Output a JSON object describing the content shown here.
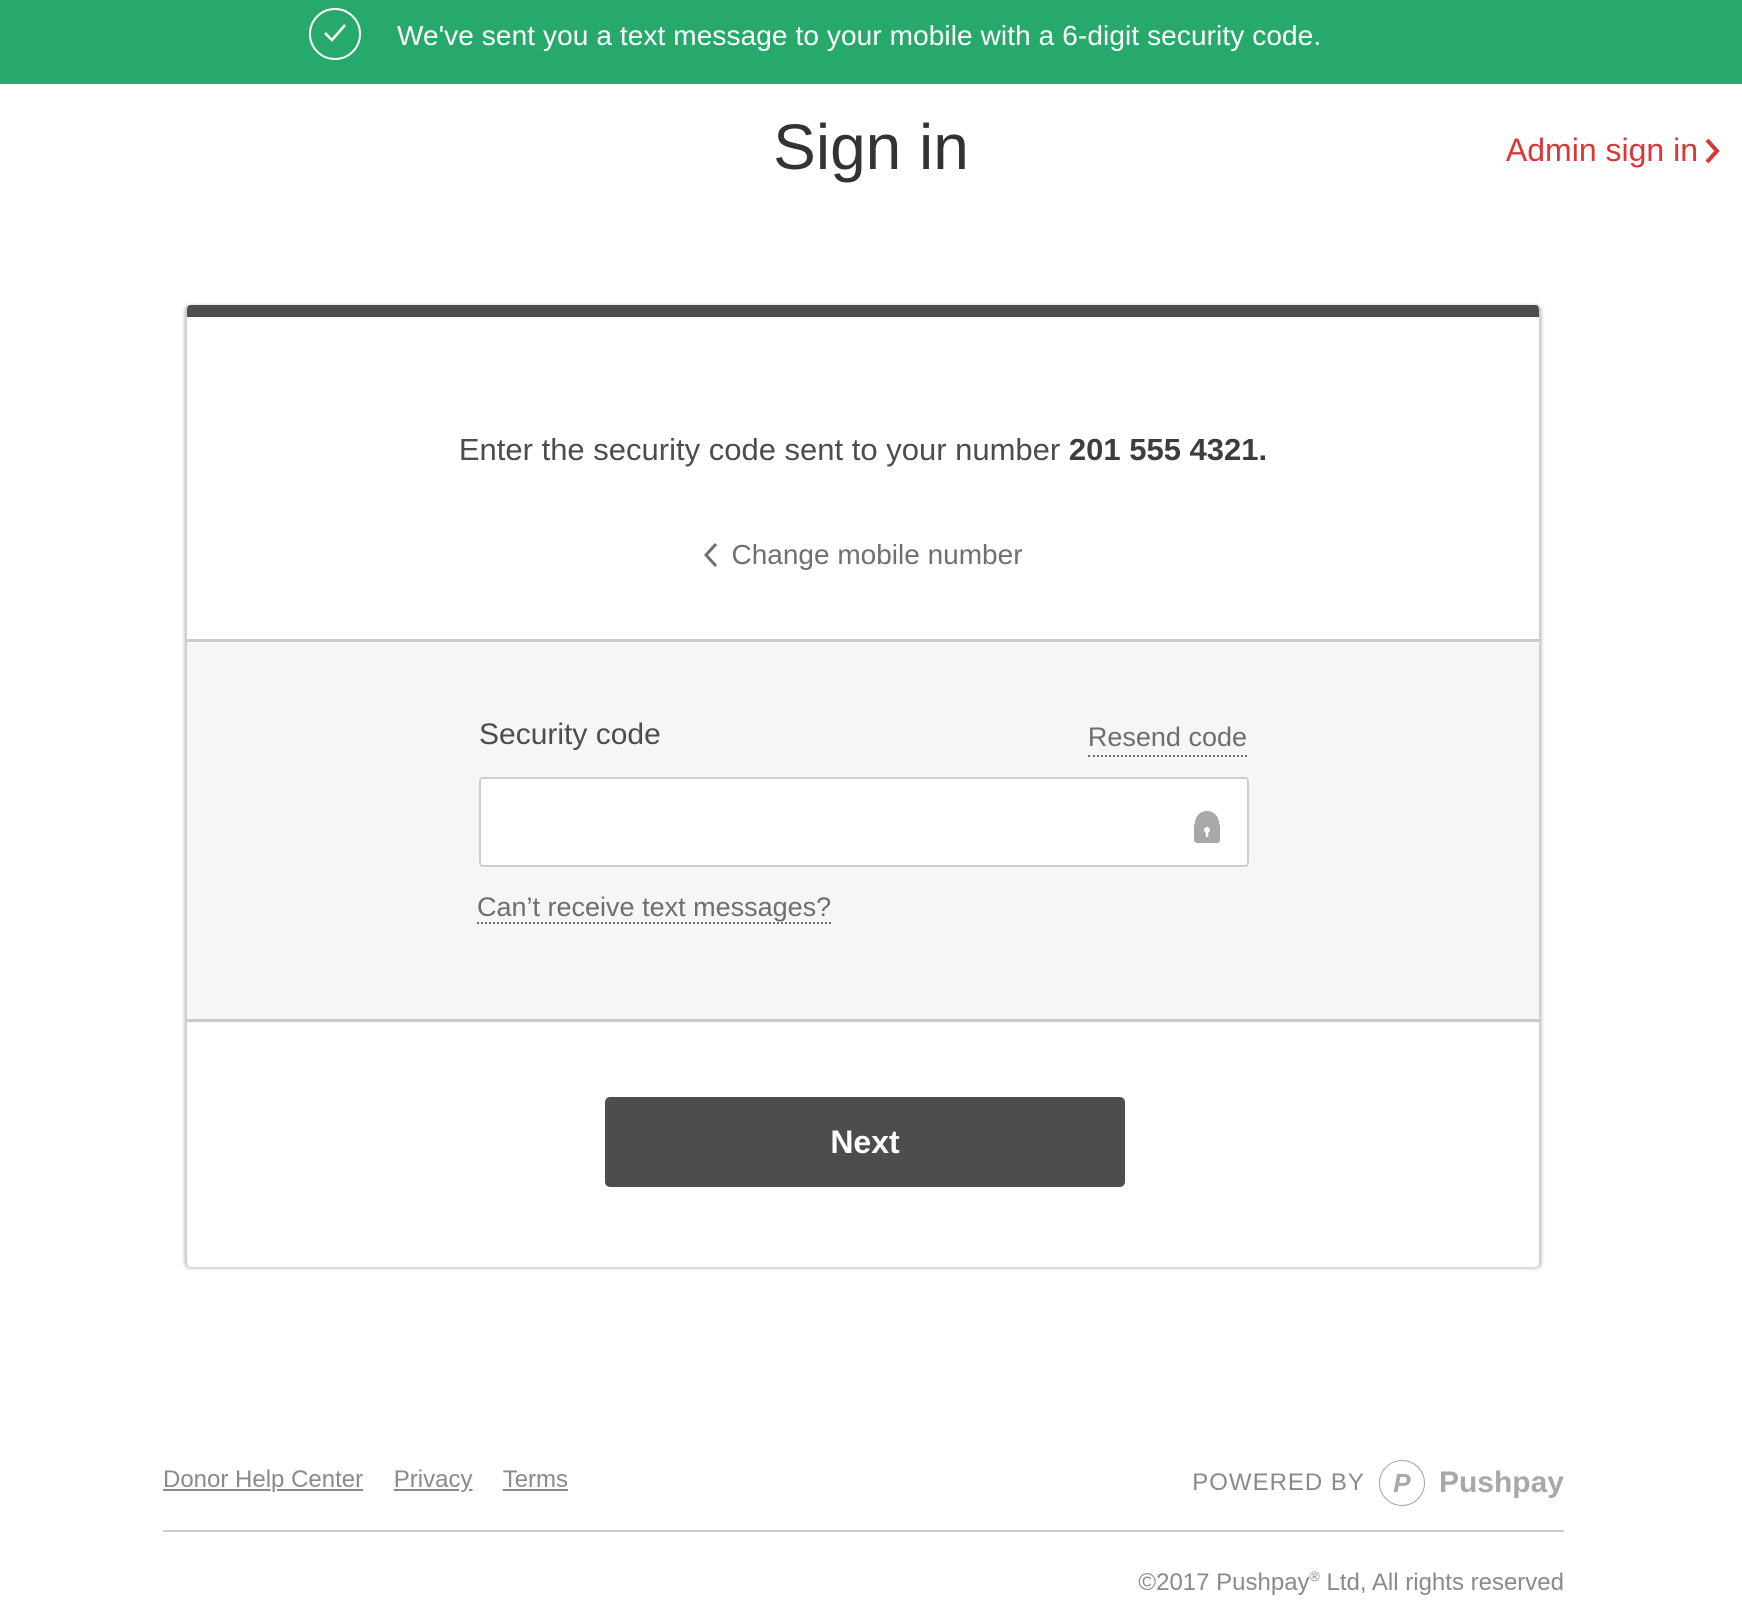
{
  "banner": {
    "icon": "check-circle-icon",
    "message": "We've sent you a text message to your mobile with a 6-digit security code.",
    "color": "#27a96c"
  },
  "header": {
    "title": "Sign in",
    "admin_link": "Admin sign in",
    "admin_icon": "chevron-right-icon",
    "admin_color": "#d9373a"
  },
  "card": {
    "prompt_text": "Enter the security code sent to your number",
    "phone_number": "201 555 4321.",
    "change_mobile": "Change mobile number",
    "change_icon": "chevron-left-icon",
    "security_code_label": "Security code",
    "resend_code": "Resend code",
    "code_input": {
      "value": "",
      "placeholder": ""
    },
    "lock_icon": "lock-icon",
    "cant_receive": "Can’t receive text messages?",
    "next_button": "Next"
  },
  "footer": {
    "links": [
      "Donor Help Center",
      "Privacy",
      "Terms"
    ],
    "powered_by": "POWERED BY",
    "logo_letter": "P",
    "brand": "Pushpay",
    "copyright_prefix": "©2017 Pushpay",
    "copyright_reg": "®",
    "copyright_suffix": " Ltd, All rights reserved"
  }
}
